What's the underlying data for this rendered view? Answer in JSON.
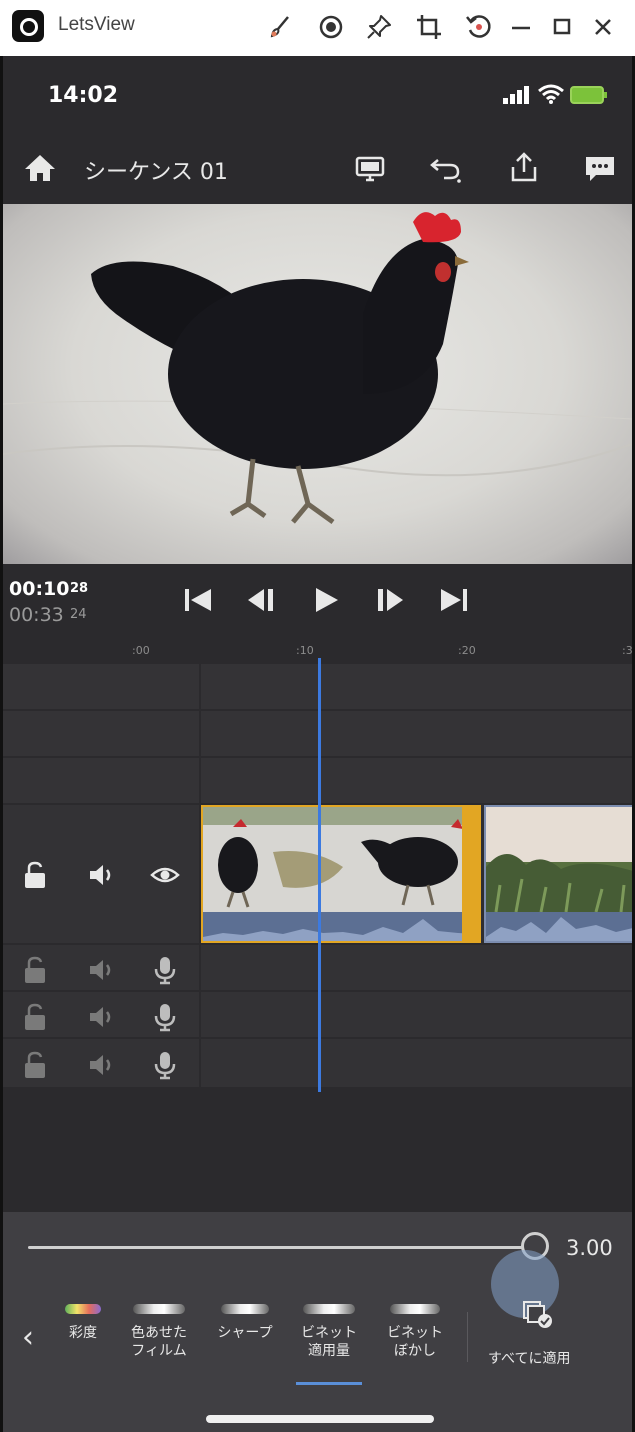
{
  "window": {
    "app_name": "LetsView",
    "toolbar_icons": [
      "brush-icon",
      "record-icon",
      "pin-icon",
      "crop-icon",
      "rotate-icon",
      "minimize-icon",
      "maximize-icon",
      "close-icon"
    ]
  },
  "status_bar": {
    "time": "14:02"
  },
  "header": {
    "sequence_title": "シーケンス 01"
  },
  "transport": {
    "current_time": "00:10",
    "current_frames": "28",
    "duration_time": "00:33",
    "duration_frames": "24"
  },
  "ruler": {
    "labels": [
      ":00",
      ":10",
      ":20",
      ":3"
    ]
  },
  "effects_panel": {
    "slider_value": "3.00",
    "slider_level_fraction": 1.0,
    "presets": [
      {
        "label_line1": "彩度",
        "label_line2": ""
      },
      {
        "label_line1": "色あせた",
        "label_line2": "フィルム"
      },
      {
        "label_line1": "シャープ",
        "label_line2": ""
      },
      {
        "label_line1": "ビネット",
        "label_line2": "適用量"
      },
      {
        "label_line1": "ビネット",
        "label_line2": "ぼかし"
      }
    ],
    "apply_all_label": "すべてに適用"
  },
  "colors": {
    "accent_clip_border": "#e2a623",
    "playhead": "#3c7ae0",
    "battery": "#7cc23a"
  }
}
